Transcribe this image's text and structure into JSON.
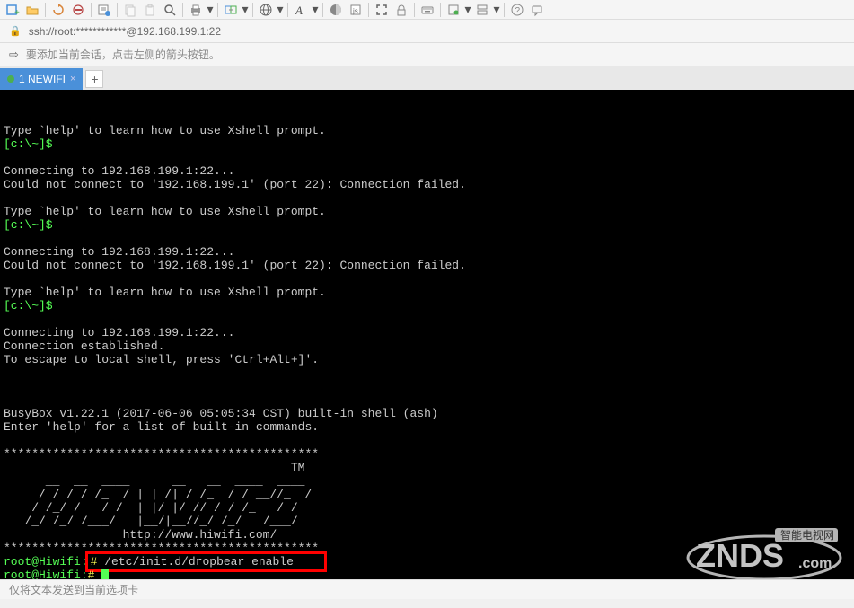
{
  "address": {
    "scheme_user": "ssh://root:************@192.168.199.1:22"
  },
  "hint": "要添加当前会话，点击左侧的箭头按钮。",
  "tabs": [
    {
      "label": "1 NEWIFI",
      "active": true
    }
  ],
  "terminal": {
    "help1": "Type `help' to learn how to use Xshell prompt.",
    "prompt_local": "[c:\\~]$",
    "connecting": "Connecting to 192.168.199.1:22...",
    "failed": "Could not connect to '192.168.199.1' (port 22): Connection failed.",
    "established": "Connection established.",
    "escape": "To escape to local shell, press 'Ctrl+Alt+]'.",
    "busybox": "BusyBox v1.22.1 (2017-06-06 05:05:34 CST) built-in shell (ash)",
    "enter_help": "Enter 'help' for a list of built-in commands.",
    "stars": "*********************************************",
    "art0": "                                         TM",
    "art1": "      __  __  ____      __   __  ____  ____ ",
    "art2": "     / / / / /_  / | | /| / /_  / / __//_  / ",
    "art3": "    / /_/ /   / /  | |/ |/ // / / /_   / /  ",
    "art4": "   /_/ /_/ /___/   |__/|__//_/ /_/   /___/  ",
    "art5": "                 http://www.hiwifi.com/",
    "root_prompt": "root@Hiwifi:",
    "cmd_symbol": "#",
    "cmd": "/etc/init.d/dropbear enable"
  },
  "status": "仅将文本发送到当前选项卡",
  "watermark": {
    "main": "ZNDS",
    "sub": "智能电视网",
    "dom": ".com"
  }
}
